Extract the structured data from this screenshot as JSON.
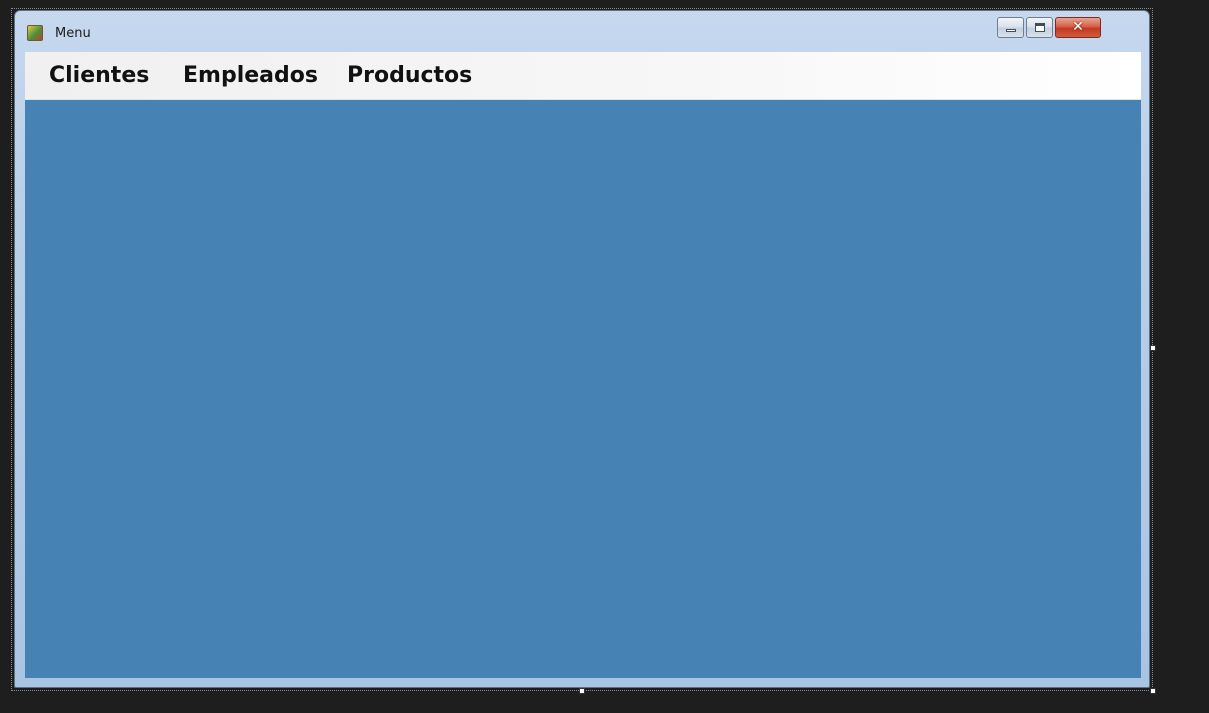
{
  "window": {
    "title": "Menu",
    "icon": "app-icon",
    "controls": {
      "minimize_icon": "minimize-icon",
      "maximize_icon": "maximize-icon",
      "close_icon": "close-icon",
      "close_glyph": "✕"
    }
  },
  "menu": {
    "items": [
      {
        "label": "Clientes"
      },
      {
        "label": "Empleados"
      },
      {
        "label": "Productos"
      }
    ]
  },
  "colors": {
    "client_background": "#4682b4",
    "menubar_background": "#f7f7f7",
    "close_button": "#c23a22",
    "designer_background": "#1e1e1e"
  }
}
